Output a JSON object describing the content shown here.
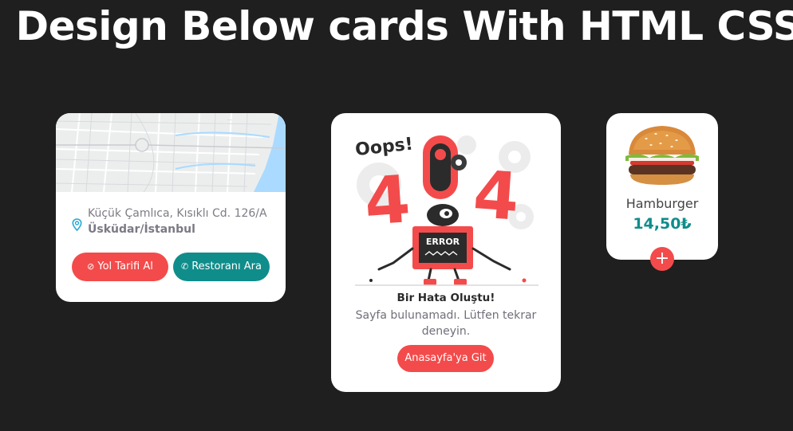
{
  "header": {
    "title": "Design Below cards With HTML CSS"
  },
  "map_card": {
    "address_line1": "Küçük Çamlıca, Kısıklı Cd. 126/A",
    "address_line2": "Üsküdar/İstanbul",
    "directions_label": "Yol Tarifi Al",
    "call_label": "Restoranı Ara",
    "icons": {
      "address": "location-pin-icon",
      "directions": "compass-icon",
      "call": "phone-icon"
    }
  },
  "error_card": {
    "illustration_text": {
      "oops": "Oops!",
      "code": "404",
      "sign": "ERROR"
    },
    "title": "Bir Hata Oluştu!",
    "description": "Sayfa bulunamadı. Lütfen tekrar deneyin.",
    "home_label": "Anasayfa'ya Git"
  },
  "food_card": {
    "name": "Hamburger",
    "price": "14,50₺",
    "add_label": "+",
    "image": "hamburger"
  },
  "colors": {
    "background": "#1f1f1f",
    "card": "#ffffff",
    "accent_red": "#f34b4b",
    "accent_teal": "#0f8d8b",
    "map_water": "#aadaff"
  }
}
